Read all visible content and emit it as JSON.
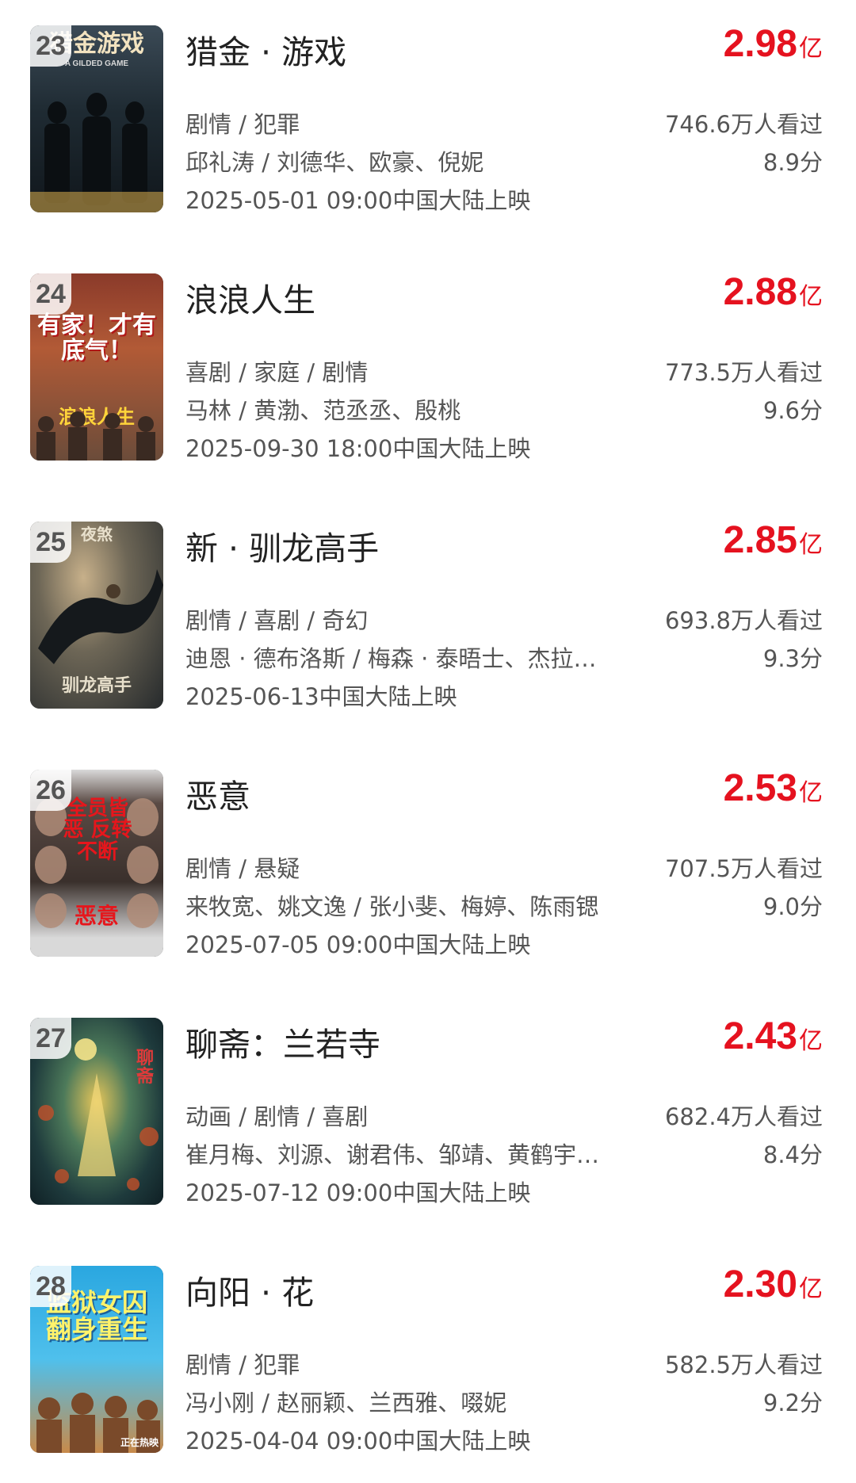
{
  "movies": [
    {
      "rank": "23",
      "title": "猎金 · 游戏",
      "box_office": "2.98",
      "unit": "亿",
      "genres": "剧情 / 犯罪",
      "viewers": "746.6万人看过",
      "people": "邱礼涛 / 刘德华、欧豪、倪妮",
      "score": "8.9分",
      "release": "2025-05-01 09:00中国大陆上映",
      "poster_text": "猎金游戏",
      "poster_sub": "A GILDED GAME"
    },
    {
      "rank": "24",
      "title": "浪浪人生",
      "box_office": "2.88",
      "unit": "亿",
      "genres": "喜剧 / 家庭 / 剧情",
      "viewers": "773.5万人看过",
      "people": "马林 / 黄渤、范丞丞、殷桃",
      "score": "9.6分",
      "release": "2025-09-30 18:00中国大陆上映",
      "poster_text": "有家！才有底气！",
      "poster_sub": "浪浪人生"
    },
    {
      "rank": "25",
      "title": "新 · 驯龙高手",
      "box_office": "2.85",
      "unit": "亿",
      "genres": "剧情 / 喜剧 / 奇幻",
      "viewers": "693.8万人看过",
      "people": "迪恩 · 德布洛斯 / 梅森 · 泰晤士、杰拉…",
      "score": "9.3分",
      "release": "2025-06-13中国大陆上映",
      "poster_text": "夜煞",
      "poster_sub": "驯龙高手"
    },
    {
      "rank": "26",
      "title": "恶意",
      "box_office": "2.53",
      "unit": "亿",
      "genres": "剧情 / 悬疑",
      "viewers": "707.5万人看过",
      "people": "来牧宽、姚文逸 / 张小斐、梅婷、陈雨锶",
      "score": "9.0分",
      "release": "2025-07-05 09:00中国大陆上映",
      "poster_text": "全员皆恶 反转不断",
      "poster_sub": "恶意"
    },
    {
      "rank": "27",
      "title": "聊斋：兰若寺",
      "box_office": "2.43",
      "unit": "亿",
      "genres": "动画 / 剧情 / 喜剧",
      "viewers": "682.4万人看过",
      "people": "崔月梅、刘源、谢君伟、邹靖、黄鹤宇…",
      "score": "8.4分",
      "release": "2025-07-12 09:00中国大陆上映",
      "poster_text": "聊斋",
      "poster_sub": ""
    },
    {
      "rank": "28",
      "title": "向阳 · 花",
      "box_office": "2.30",
      "unit": "亿",
      "genres": "剧情 / 犯罪",
      "viewers": "582.5万人看过",
      "people": "冯小刚 / 赵丽颖、兰西雅、啜妮",
      "score": "9.2分",
      "release": "2025-04-04 09:00中国大陆上映",
      "poster_text": "监狱女囚 翻身重生",
      "poster_sub": "正在热映"
    }
  ]
}
